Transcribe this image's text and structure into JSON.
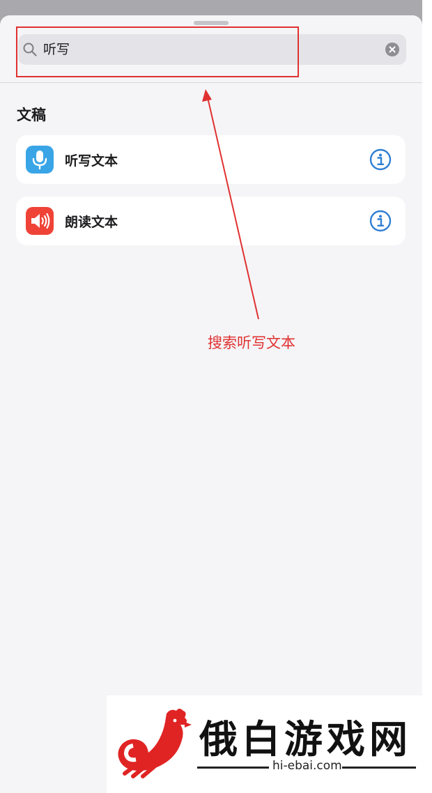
{
  "search": {
    "query": "听写",
    "icon": "magnifying-glass-icon",
    "clear_icon": "clear-x-icon"
  },
  "section": {
    "title": "文稿"
  },
  "actions": [
    {
      "label": "听写文本",
      "icon": "microphone-icon",
      "icon_color": "#3aa5e6",
      "info_icon": "info-circle-icon"
    },
    {
      "label": "朗读文本",
      "icon": "speaker-icon",
      "icon_color": "#f04338",
      "info_icon": "info-circle-icon"
    }
  ],
  "annotation": {
    "text": "搜索听写文本",
    "color": "#e03131"
  },
  "watermark": {
    "title": "俄白游戏网",
    "url": "hi-ebai.com",
    "logo": "rooster-logo-icon",
    "logo_color": "#e02424"
  },
  "colors": {
    "accent_blue": "#2f7fd3"
  }
}
